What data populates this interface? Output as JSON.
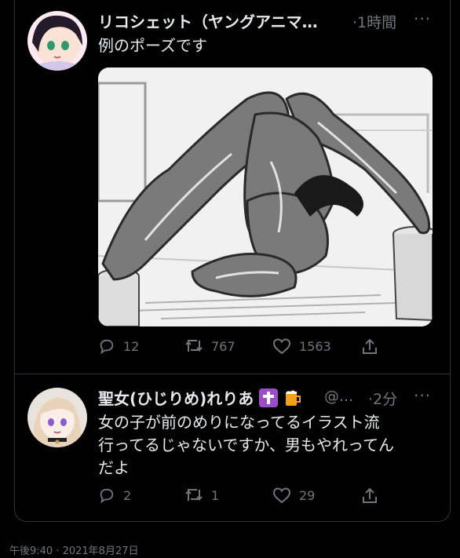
{
  "tweet1": {
    "display_name": "リコシェット（ヤングアニマ…",
    "time": "·1時間",
    "more": "···",
    "text": "例のポーズです",
    "reply_count": "12",
    "retweet_count": "767",
    "like_count": "1563"
  },
  "tweet2": {
    "display_name": "聖女(ひじりめ)れりあ",
    "handle": "@...",
    "time": "·2分",
    "more": "···",
    "text_line1": "女の子が前のめりになってるイラスト流",
    "text_line2": "行ってるじゃないですか、男もやれってん",
    "text_line3": "だよ",
    "reply_count": "2",
    "retweet_count": "1",
    "like_count": "29"
  },
  "footer": {
    "timestamp": "午後9:40 · 2021年8月27日"
  },
  "colors": {
    "bg": "#000000",
    "text": "#e7e9ea",
    "muted": "#71767b",
    "border": "#2f3336",
    "cross_emoji": "#9b4dca",
    "beer_emoji": "#f3a11b"
  },
  "icons": [
    "reply-icon",
    "retweet-icon",
    "like-icon",
    "share-icon",
    "latin-cross-emoji",
    "beer-mug-emoji"
  ]
}
